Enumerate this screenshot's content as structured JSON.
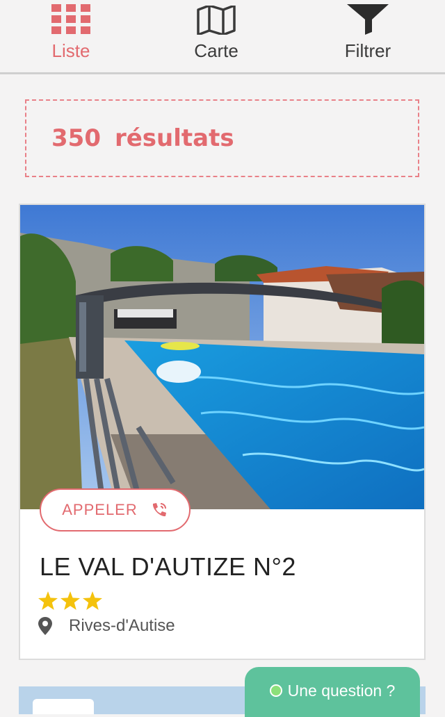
{
  "tabs": [
    {
      "label": "Liste",
      "icon": "grid-icon",
      "active": true
    },
    {
      "label": "Carte",
      "icon": "map-icon",
      "active": false
    },
    {
      "label": "Filtrer",
      "icon": "filter-icon",
      "active": false
    }
  ],
  "results": {
    "count": "350",
    "word": "résultats"
  },
  "listing": {
    "call_label": "APPELER",
    "call_icon": "phone-icon",
    "title": "LE VAL D'AUTIZE N°2",
    "stars": 3,
    "location_icon": "map-pin-icon",
    "location": "Rives-d'Autise",
    "photo": "covered swimming pool"
  },
  "chat": {
    "label": "Une question ?"
  },
  "colors": {
    "accent": "#e26a6f",
    "chat": "#5ec29c",
    "star": "#f4c20d"
  }
}
